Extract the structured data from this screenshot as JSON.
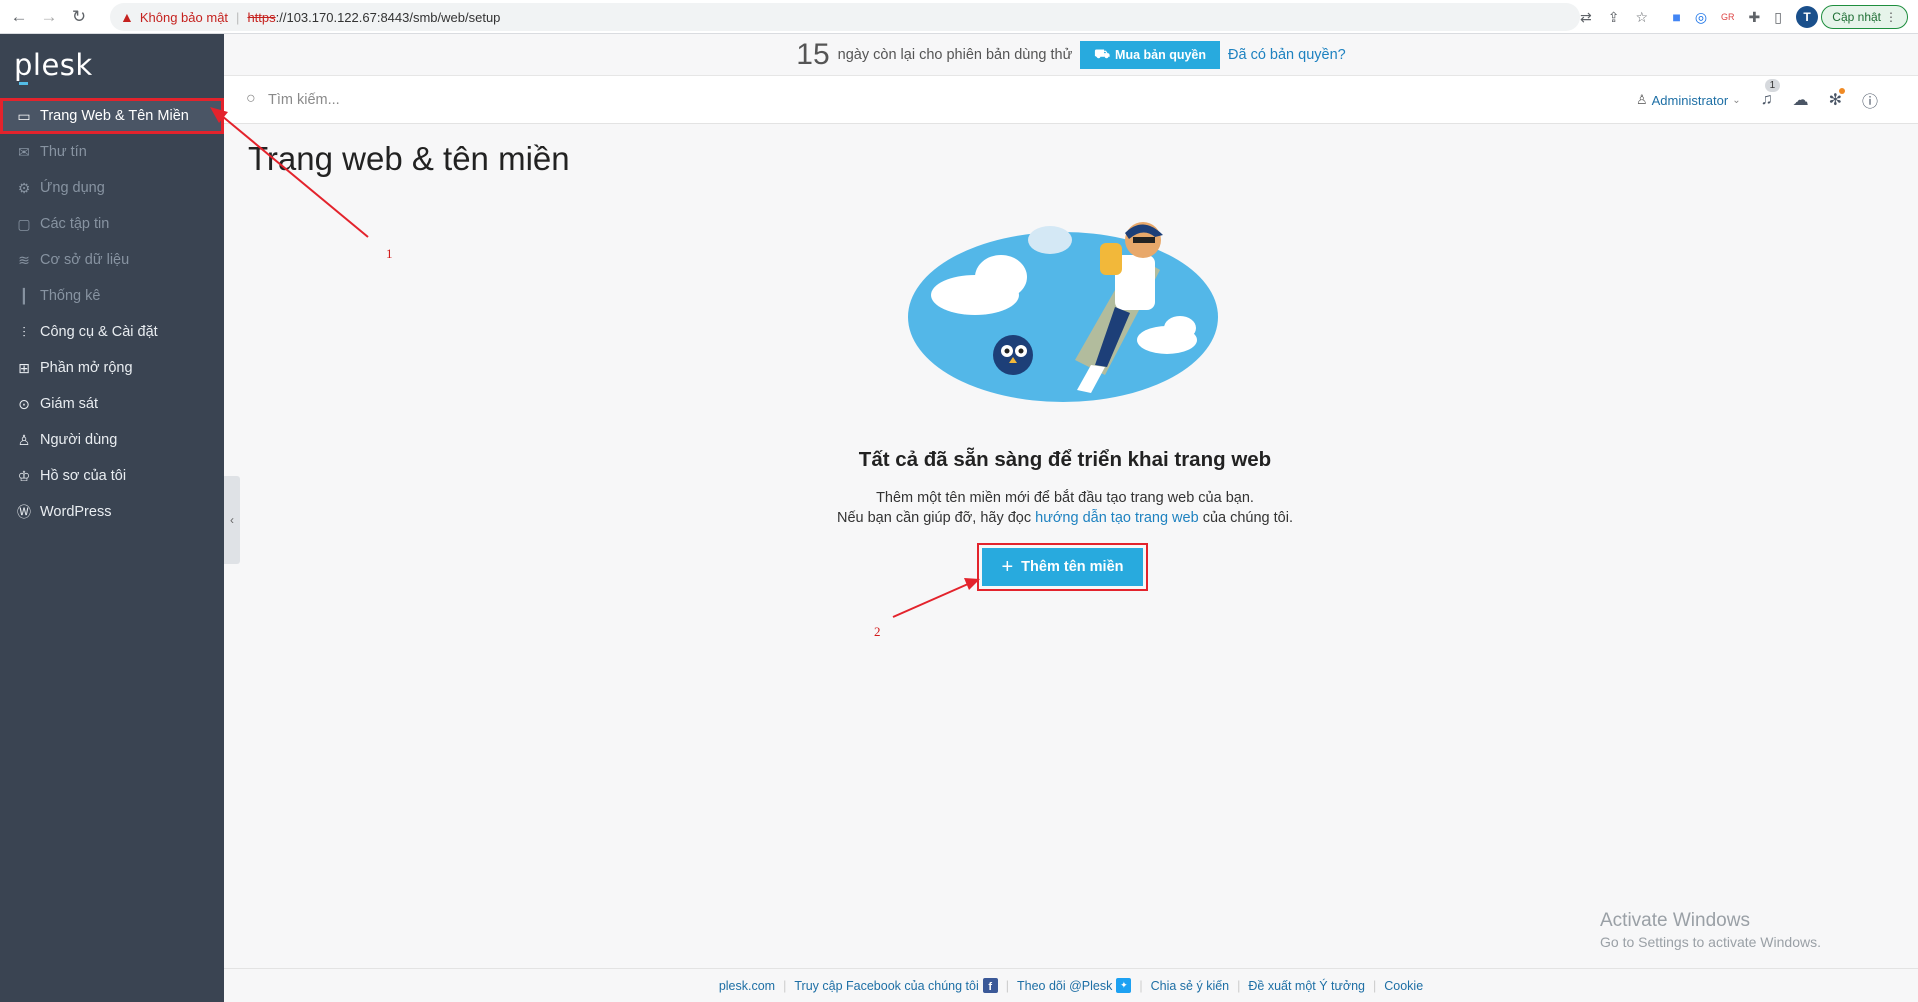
{
  "browser": {
    "security_warning": "Không bảo mật",
    "url_scheme": "https",
    "url_rest": "://103.170.122.67:8443/smb/web/setup",
    "avatar_letter": "T",
    "update_label": "Cập nhật"
  },
  "sidebar": {
    "logo": "plesk",
    "items": [
      {
        "label": "Trang Web & Tên Miền",
        "icon": "monitor-icon",
        "state": "active"
      },
      {
        "label": "Thư tín",
        "icon": "mail-icon",
        "state": "dim"
      },
      {
        "label": "Ứng dụng",
        "icon": "gear-icon",
        "state": "dim"
      },
      {
        "label": "Các tập tin",
        "icon": "folder-icon",
        "state": "dim"
      },
      {
        "label": "Cơ sở dữ liệu",
        "icon": "database-icon",
        "state": "dim"
      },
      {
        "label": "Thống kê",
        "icon": "bar-chart-icon",
        "state": "dim"
      },
      {
        "label": "Công cụ & Cài đặt",
        "icon": "sliders-icon",
        "state": "normal"
      },
      {
        "label": "Phần mở rộng",
        "icon": "extensions-icon",
        "state": "normal"
      },
      {
        "label": "Giám sát",
        "icon": "monitor-search-icon",
        "state": "normal"
      },
      {
        "label": "Người dùng",
        "icon": "user-icon",
        "state": "normal"
      },
      {
        "label": "Hồ sơ của tôi",
        "icon": "profile-icon",
        "state": "normal"
      },
      {
        "label": "WordPress",
        "icon": "wordpress-icon",
        "state": "normal"
      }
    ]
  },
  "trial": {
    "days": "15",
    "text": "ngày còn lại cho phiên bản dùng thử",
    "buy_label": "Mua bản quyền",
    "have_license": "Đã có bản quyền?"
  },
  "header": {
    "search_placeholder": "Tìm kiếm...",
    "user": "Administrator",
    "notification_count": "1"
  },
  "main": {
    "title": "Trang web & tên miền",
    "empty_title": "Tất cả đã sẵn sàng để triển khai trang web",
    "desc_line1": "Thêm một tên miền mới để bắt đầu tạo trang web của bạn.",
    "desc_line2_pre": "Nếu bạn cần giúp đỡ, hãy đọc",
    "desc_link": "hướng dẫn tạo trang web",
    "desc_line2_post": "của chúng tôi.",
    "add_button": "Thêm tên miền"
  },
  "annotations": {
    "num1": "1",
    "num2": "2",
    "color": "#e3232c"
  },
  "windows_watermark": {
    "line1": "Activate Windows",
    "line2": "Go to Settings to activate Windows."
  },
  "footer": {
    "links": [
      "plesk.com",
      "Truy cập Facebook của chúng tôi",
      "Theo dõi @Plesk",
      "Chia sẻ ý kiến",
      "Đề xuất một Ý tưởng",
      "Cookie"
    ]
  }
}
